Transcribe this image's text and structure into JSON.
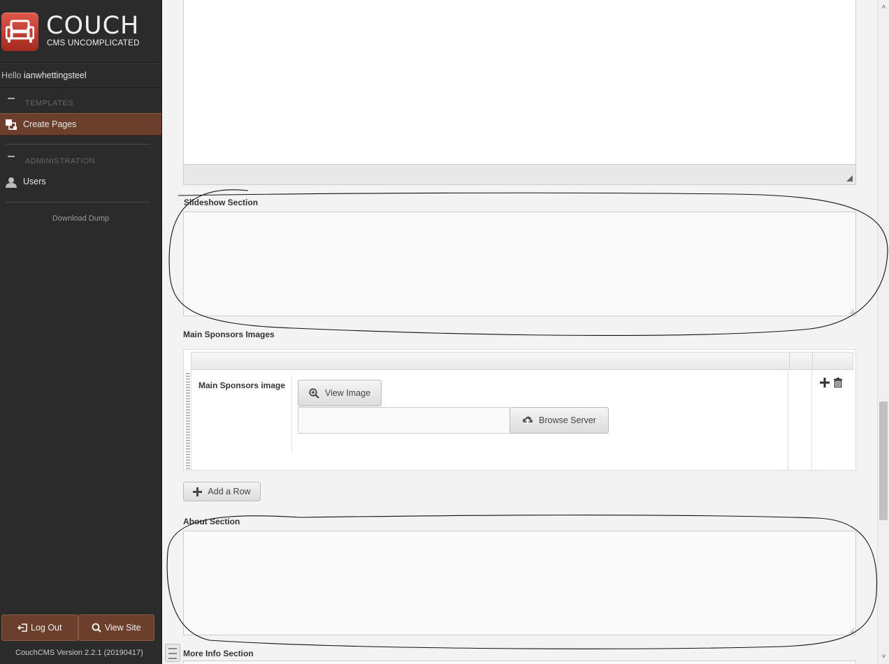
{
  "brand": {
    "title": "COUCH",
    "subtitle": "CMS UNCOMPLICATED"
  },
  "user": {
    "greeting": "Hello",
    "name": "ianwhettingsteel"
  },
  "sidebar": {
    "templates_header": "TEMPLATES",
    "create_pages": "Create Pages",
    "admin_header": "ADMINISTRATION",
    "users": "Users",
    "download_dump": "Download Dump",
    "logout": "Log Out",
    "view_site": "View Site",
    "version": "CouchCMS Version 2.2.1 (20190417)"
  },
  "form": {
    "slideshow_label": "Slideshow Section",
    "sponsors_label": "Main Sponsors Images",
    "sponsor_image_label": "Main Sponsors image",
    "view_image": "View Image",
    "browse_server": "Browse Server",
    "add_row": "Add a Row",
    "about_label": "About Section",
    "more_info_label": "More Info Section"
  },
  "colors": {
    "sidebar_bg": "#2b2b2b",
    "active_item": "#6b3f2c",
    "brand_red": "#c0392b"
  }
}
